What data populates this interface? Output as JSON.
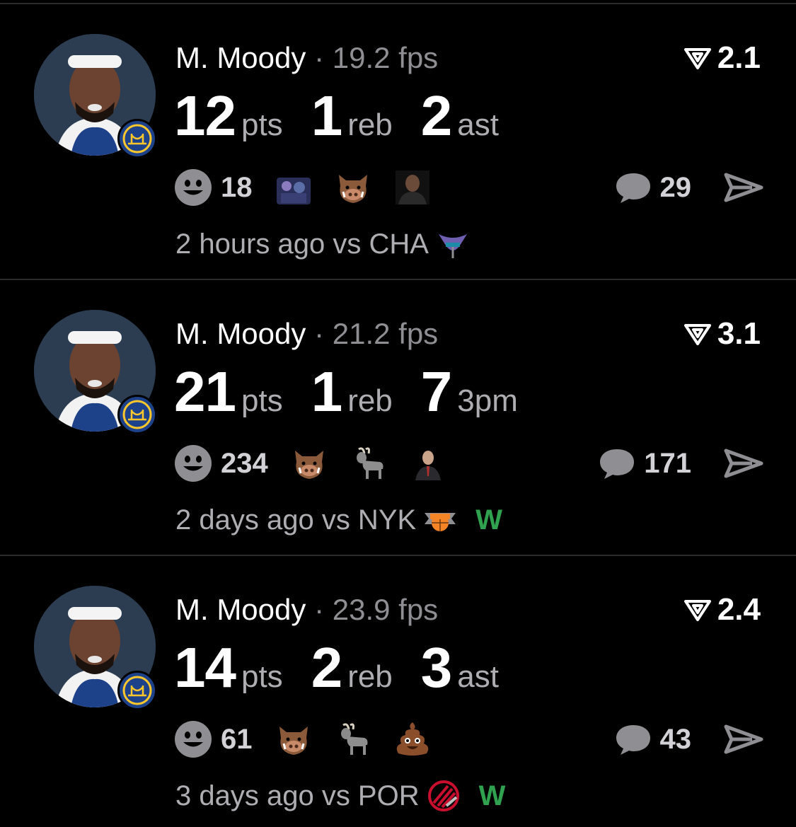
{
  "colors": {
    "background": "#000000",
    "muted": "#8e8e93",
    "win": "#30a14e",
    "warriors_blue": "#1d428a",
    "warriors_gold": "#ffc72c"
  },
  "posts": [
    {
      "player_name": "M. Moody",
      "separator": "·",
      "fps": "19.2 fps",
      "rating": "2.1",
      "stats": [
        {
          "value": "12",
          "label": "pts"
        },
        {
          "value": "1",
          "label": "reb"
        },
        {
          "value": "2",
          "label": "ast"
        }
      ],
      "reaction_count": "18",
      "reaction_icons": [
        "cartoon-crowd-image",
        "boar-emoji",
        "person-photo"
      ],
      "comment_count": "29",
      "time_opponent": "2 hours ago vs CHA",
      "opponent_logo": "hornets-logo",
      "result": ""
    },
    {
      "player_name": "M. Moody",
      "separator": "·",
      "fps": "21.2 fps",
      "rating": "3.1",
      "stats": [
        {
          "value": "21",
          "label": "pts"
        },
        {
          "value": "1",
          "label": "reb"
        },
        {
          "value": "7",
          "label": "3pm"
        }
      ],
      "reaction_count": "234",
      "reaction_icons": [
        "boar-emoji",
        "goat-emoji",
        "person-in-suit-photo"
      ],
      "comment_count": "171",
      "time_opponent": "2 days ago vs NYK",
      "opponent_logo": "knicks-logo",
      "result": "W"
    },
    {
      "player_name": "M. Moody",
      "separator": "·",
      "fps": "23.9 fps",
      "rating": "2.4",
      "stats": [
        {
          "value": "14",
          "label": "pts"
        },
        {
          "value": "2",
          "label": "reb"
        },
        {
          "value": "3",
          "label": "ast"
        }
      ],
      "reaction_count": "61",
      "reaction_icons": [
        "boar-emoji",
        "goat-emoji",
        "poop-emoji"
      ],
      "comment_count": "43",
      "time_opponent": "3 days ago vs POR",
      "opponent_logo": "trail-blazers-logo",
      "result": "W"
    }
  ]
}
